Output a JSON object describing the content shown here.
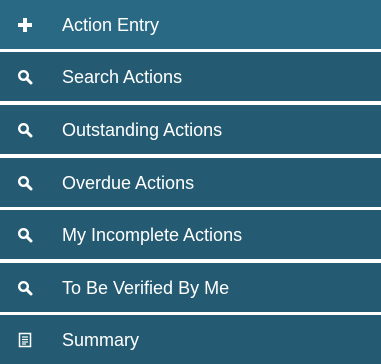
{
  "menu": {
    "background_color": "#245b72",
    "text_color": "#ffffff",
    "items": [
      {
        "label": "Action Entry",
        "icon": "plus-icon"
      },
      {
        "label": "Search Actions",
        "icon": "search-icon"
      },
      {
        "label": "Outstanding Actions",
        "icon": "search-icon"
      },
      {
        "label": "Overdue Actions",
        "icon": "search-icon"
      },
      {
        "label": "My Incomplete Actions",
        "icon": "search-icon"
      },
      {
        "label": "To Be Verified By Me",
        "icon": "search-icon"
      },
      {
        "label": "Summary",
        "icon": "document-icon"
      }
    ]
  }
}
